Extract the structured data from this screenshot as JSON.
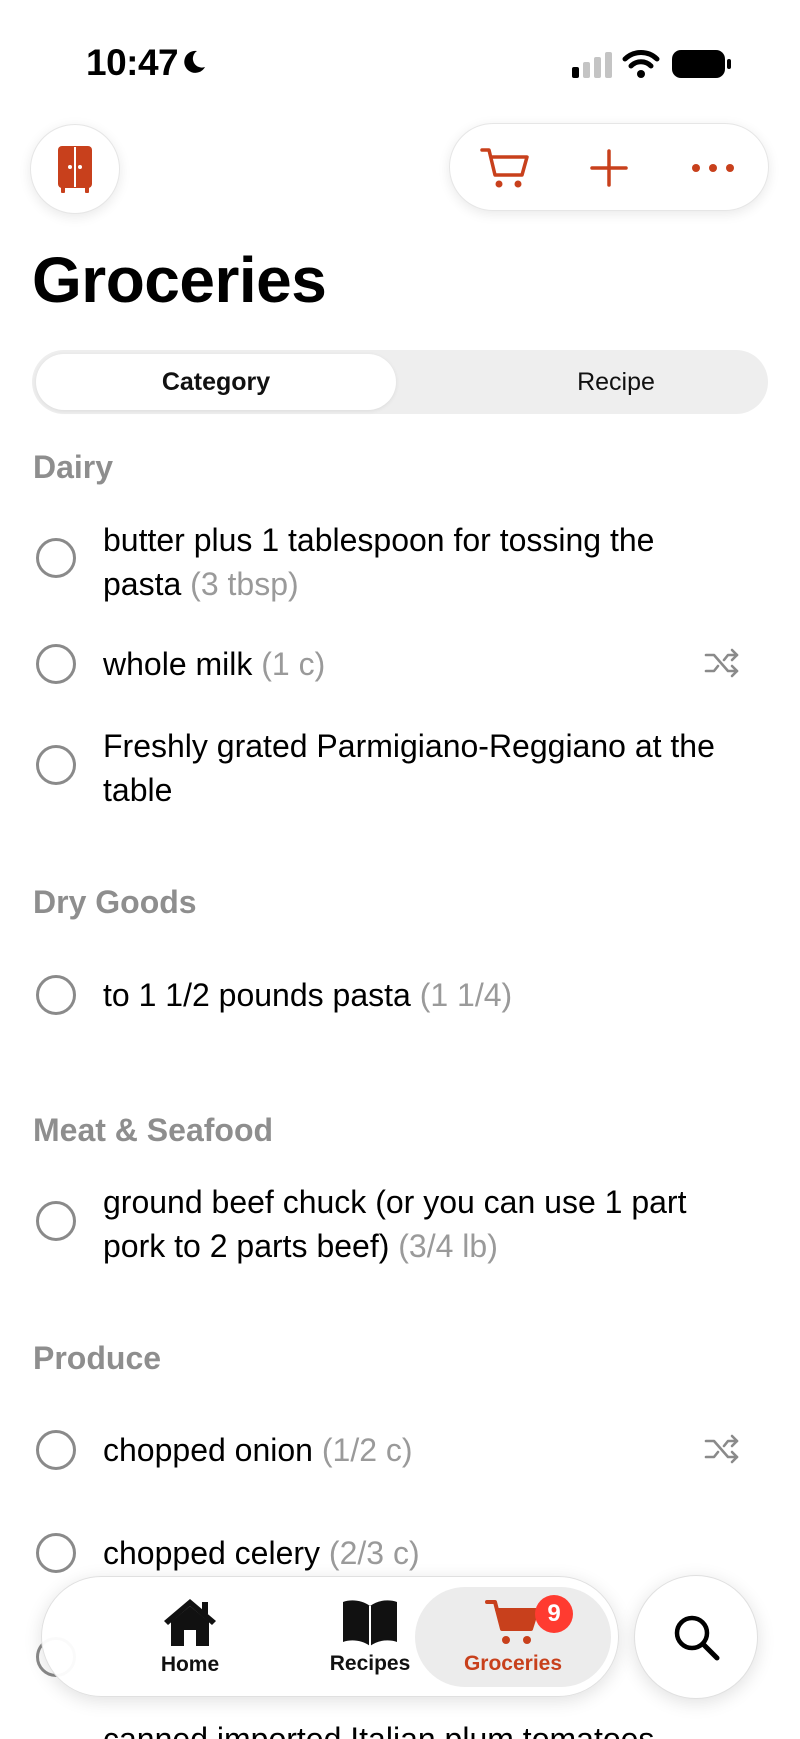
{
  "status_bar": {
    "time": "10:47"
  },
  "colors": {
    "accent": "#C8401C",
    "secondary_text": "#9A9A9A",
    "badge": "#FF3B30"
  },
  "header": {
    "left_icon": "pantry-cabinet-icon",
    "actions": [
      {
        "icon": "cart-icon"
      },
      {
        "icon": "plus-icon"
      },
      {
        "icon": "ellipsis-icon"
      }
    ]
  },
  "page_title": "Groceries",
  "segmented": {
    "selected": "Category",
    "options": [
      "Category",
      "Recipe"
    ]
  },
  "categories": [
    {
      "name": "Dairy",
      "items": [
        {
          "text": "butter plus 1 tablespoon for tossing the pasta",
          "qty": "(3 tbsp)",
          "checked": false,
          "substitute": false
        },
        {
          "text": "whole milk",
          "qty": "(1 c)",
          "checked": false,
          "substitute": true
        },
        {
          "text": "Freshly grated Parmigiano-Reggiano at the table",
          "qty": "",
          "checked": false,
          "substitute": false
        }
      ]
    },
    {
      "name": "Dry Goods",
      "items": [
        {
          "text": "to 1 1/2 pounds pasta",
          "qty": "(1 1/4)",
          "checked": false,
          "substitute": false
        }
      ]
    },
    {
      "name": "Meat & Seafood",
      "items": [
        {
          "text": "ground beef chuck (or you can use 1 part pork to 2 parts beef)",
          "qty": "(3/4 lb)",
          "checked": false,
          "substitute": false
        }
      ]
    },
    {
      "name": "Produce",
      "items": [
        {
          "text": "chopped onion",
          "qty": "(1/2 c)",
          "checked": false,
          "substitute": true
        },
        {
          "text": "chopped celery",
          "qty": "(2/3 c)",
          "checked": false,
          "substitute": false
        },
        {
          "text": "canned imported Italian plum tomatoes",
          "qty": "",
          "checked": false,
          "substitute": false
        }
      ]
    }
  ],
  "tab_bar": {
    "tabs": [
      {
        "label": "Home",
        "icon": "house-icon",
        "active": false
      },
      {
        "label": "Recipes",
        "icon": "book-icon",
        "active": false
      },
      {
        "label": "Groceries",
        "icon": "cart-icon",
        "active": true,
        "badge": "9"
      }
    ],
    "search_icon": "search-icon"
  }
}
